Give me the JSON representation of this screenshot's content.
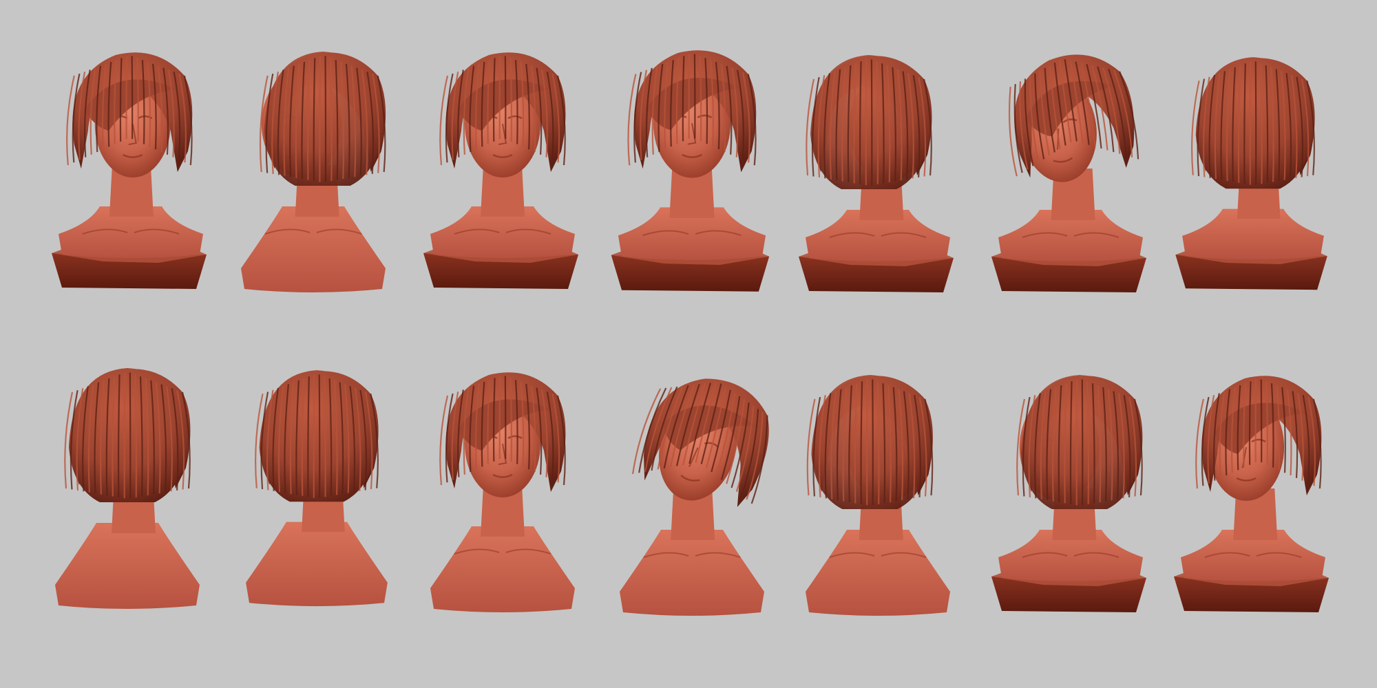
{
  "canvas": {
    "background": "#c6c6c6"
  },
  "palette": {
    "skin": "#c8624a",
    "skin_light": "#e07a5e",
    "skin_dark": "#8e3422",
    "hair": "#9c4430",
    "hair_dark": "#5e2014",
    "base_top": "#b0503a",
    "base_side": "#6e2414"
  },
  "renders": [
    {
      "id": "bust-1",
      "view": "front-left-three-quarter",
      "base": "plinth"
    },
    {
      "id": "bust-2",
      "view": "left-profile-rear",
      "base": "none"
    },
    {
      "id": "bust-3",
      "view": "front",
      "base": "plinth"
    },
    {
      "id": "bust-4",
      "view": "front",
      "base": "plinth"
    },
    {
      "id": "bust-5",
      "view": "right-profile",
      "base": "plinth"
    },
    {
      "id": "bust-6",
      "view": "left-three-quarter-up",
      "base": "plinth"
    },
    {
      "id": "bust-7",
      "view": "back-three-quarter",
      "base": "plinth"
    },
    {
      "id": "bust-8",
      "view": "back-three-quarter",
      "base": "none"
    },
    {
      "id": "bust-9",
      "view": "back",
      "base": "none"
    },
    {
      "id": "bust-10",
      "view": "front-low",
      "base": "none"
    },
    {
      "id": "bust-11",
      "view": "front-down-tilt",
      "base": "none"
    },
    {
      "id": "bust-12",
      "view": "right-three-quarter",
      "base": "none"
    },
    {
      "id": "bust-13",
      "view": "left-profile",
      "base": "plinth"
    },
    {
      "id": "bust-14",
      "view": "left-three-quarter",
      "base": "plinth"
    }
  ]
}
